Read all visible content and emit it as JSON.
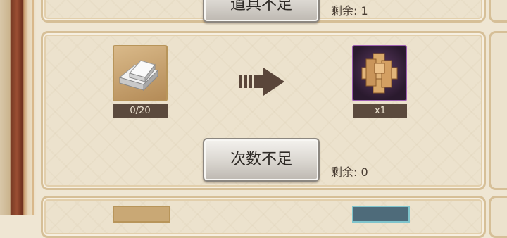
{
  "rows": [
    {
      "button_label": "道具不足",
      "remaining": "剩余: 1"
    },
    {
      "input_item": {
        "icon": "silver-ingot-icon",
        "count": "0/20"
      },
      "output_item": {
        "icon": "wooden-puzzle-icon",
        "count": "x1"
      },
      "button_label": "次数不足",
      "remaining": "剩余: 0"
    }
  ],
  "colors": {
    "label_bg": "#5b4a3d",
    "arrow": "#5a463a",
    "frame_wood": "#7b3c25",
    "rare_border": "#9d5fb0"
  }
}
